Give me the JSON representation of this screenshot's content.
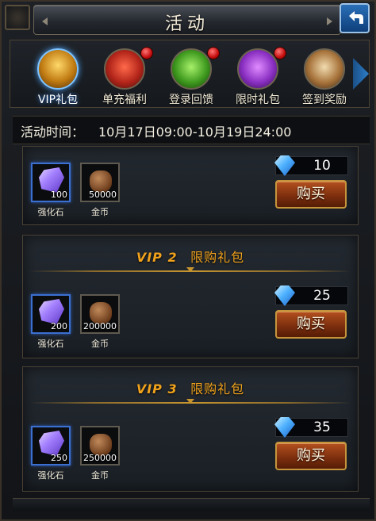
{
  "title": "活动",
  "tabs": [
    {
      "label": "VIP礼包",
      "active": true,
      "icon": "treasure-chest-icon",
      "badge": false
    },
    {
      "label": "单充福利",
      "active": false,
      "icon": "gift-box-icon",
      "badge": true
    },
    {
      "label": "登录回馈",
      "active": false,
      "icon": "green-gift-icon",
      "badge": true
    },
    {
      "label": "限时礼包",
      "active": false,
      "icon": "purple-chest-icon",
      "badge": true
    },
    {
      "label": "签到奖励",
      "active": false,
      "icon": "book-icon",
      "badge": false
    }
  ],
  "activity_time": {
    "label": "活动时间：",
    "value": "10月17日09:00-10月19日24:00"
  },
  "packages": [
    {
      "vip": "",
      "gift_name": "",
      "items": [
        {
          "name": "强化石",
          "qty": "100",
          "icon": "gem-icon"
        },
        {
          "name": "金币",
          "qty": "50000",
          "icon": "coin-bag-icon"
        }
      ],
      "price": "10",
      "buy_label": "购买"
    },
    {
      "vip": "VIP 2",
      "gift_name": "限购礼包",
      "items": [
        {
          "name": "强化石",
          "qty": "200",
          "icon": "gem-icon"
        },
        {
          "name": "金币",
          "qty": "200000",
          "icon": "coin-bag-icon"
        }
      ],
      "price": "25",
      "buy_label": "购买"
    },
    {
      "vip": "VIP 3",
      "gift_name": "限购礼包",
      "items": [
        {
          "name": "强化石",
          "qty": "250",
          "icon": "gem-icon"
        },
        {
          "name": "金币",
          "qty": "250000",
          "icon": "coin-bag-icon"
        }
      ],
      "price": "35",
      "buy_label": "购买"
    }
  ],
  "colors": {
    "accent_gold": "#f0a21c",
    "buy_button": "#7a2d0d",
    "active_tab_glow": "#3a8cff"
  }
}
